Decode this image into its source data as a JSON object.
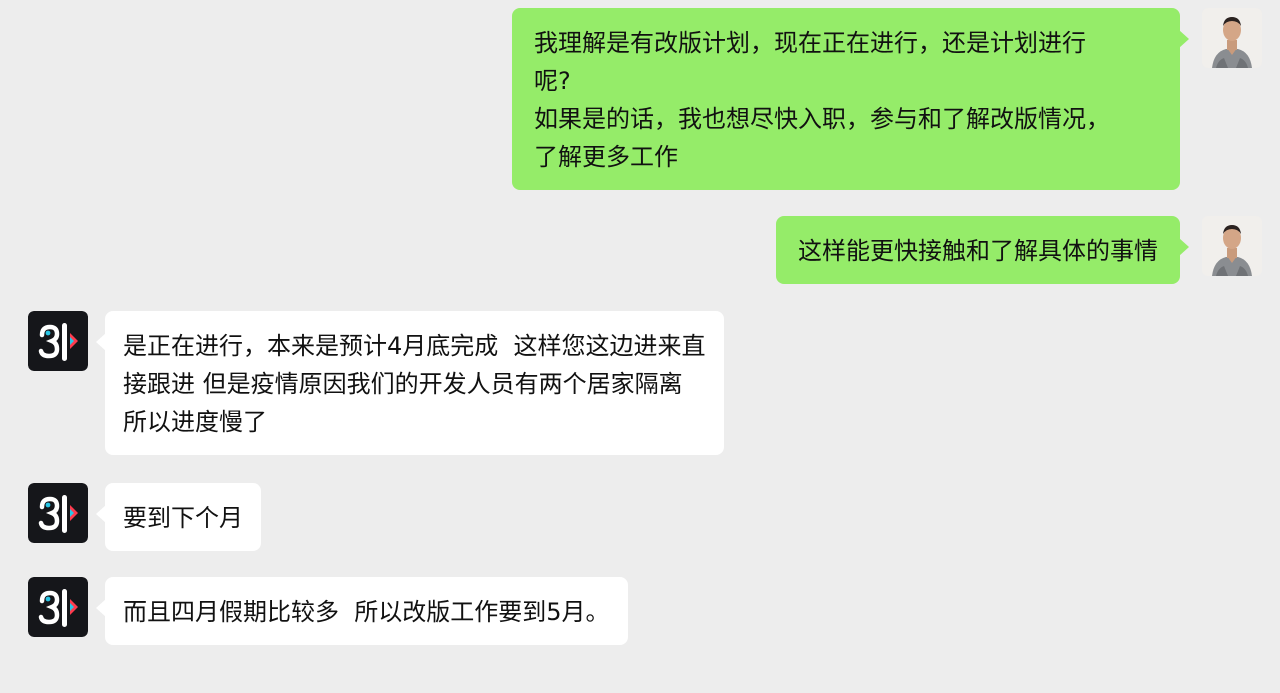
{
  "messages": [
    {
      "side": "right",
      "lines": [
        "我理解是有改版计划，现在正在进行，还是计划进行",
        "呢?",
        "如果是的话，我也想尽快入职，参与和了解改版情况，",
        "了解更多工作"
      ]
    },
    {
      "side": "right",
      "lines": [
        "这样能更快接触和了解具体的事情"
      ]
    },
    {
      "side": "left",
      "lines": [
        "是正在进行，本来是预计4月底完成  这样您这边进来直",
        "接跟进 但是疫情原因我们的开发人员有两个居家隔离",
        "所以进度慢了"
      ]
    },
    {
      "side": "left",
      "lines": [
        "要到下个月"
      ]
    },
    {
      "side": "left",
      "lines": [
        "而且四月假期比较多  所以改版工作要到5月。"
      ]
    }
  ],
  "avatars": {
    "me": "user-photo-avatar",
    "them": "company-logo-avatar"
  },
  "colors": {
    "background": "#ededed",
    "my_bubble": "#95ec69",
    "their_bubble": "#ffffff",
    "logo_red": "#ff3b4e",
    "logo_blue": "#29c6e6"
  },
  "timestamp": ""
}
